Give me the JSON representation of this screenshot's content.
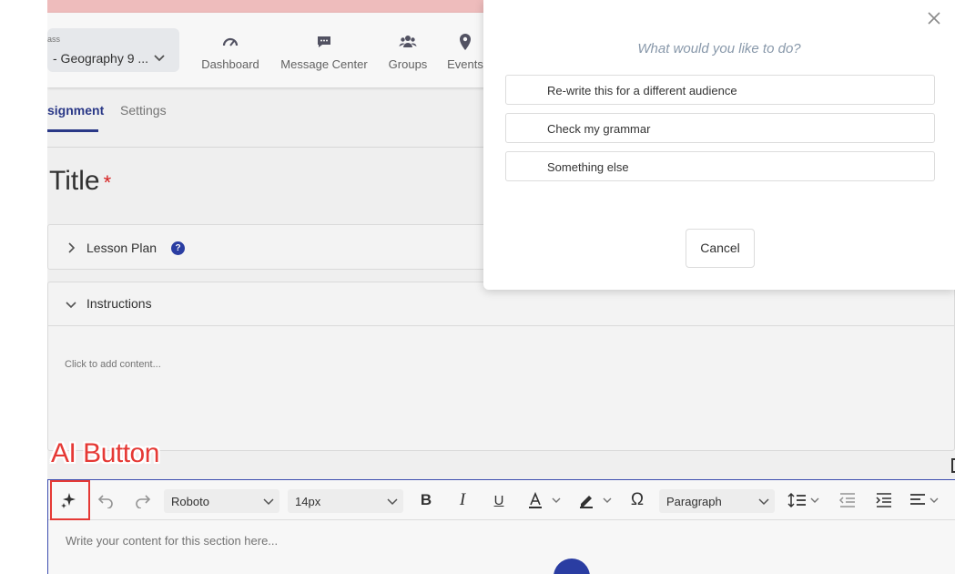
{
  "banner": {
    "color": "#f6c3c3"
  },
  "nav": {
    "class_label": "ass",
    "class_value": "- Geography 9 ...",
    "items": [
      {
        "label": "Dashboard",
        "icon": "gauge-icon"
      },
      {
        "label": "Message Center",
        "icon": "chat-icon"
      },
      {
        "label": "Groups",
        "icon": "users-icon"
      },
      {
        "label": "Events",
        "icon": "map-pin-icon"
      }
    ]
  },
  "tabs": {
    "assignment": "signment",
    "settings": "Settings"
  },
  "form": {
    "title": "Title",
    "required_mark": "*",
    "lesson_plan": "Lesson Plan",
    "help": "?",
    "instructions": "Instructions",
    "instructions_placeholder": "Click to add content..."
  },
  "editor": {
    "font": "Roboto",
    "size": "14px",
    "block": "Paragraph",
    "placeholder": "Write your content for this section here...",
    "tools": [
      "ai-sparkle-icon",
      "undo-icon",
      "redo-icon",
      "bold-icon",
      "italic-icon",
      "underline-icon",
      "text-color-icon",
      "highlight-icon",
      "omega-icon",
      "line-height-icon",
      "outdent-icon",
      "indent-icon",
      "align-left-icon"
    ]
  },
  "annotation": {
    "label": "AI Button",
    "color": "#e53935"
  },
  "modal": {
    "question": "What would you like to do?",
    "options": [
      "Re-write this for a different audience",
      "Check my grammar",
      "Something else"
    ],
    "cancel": "Cancel"
  },
  "colors": {
    "primary": "#2c3fa8",
    "accent_tab": "#2c3a8c",
    "required": "#d22222"
  }
}
